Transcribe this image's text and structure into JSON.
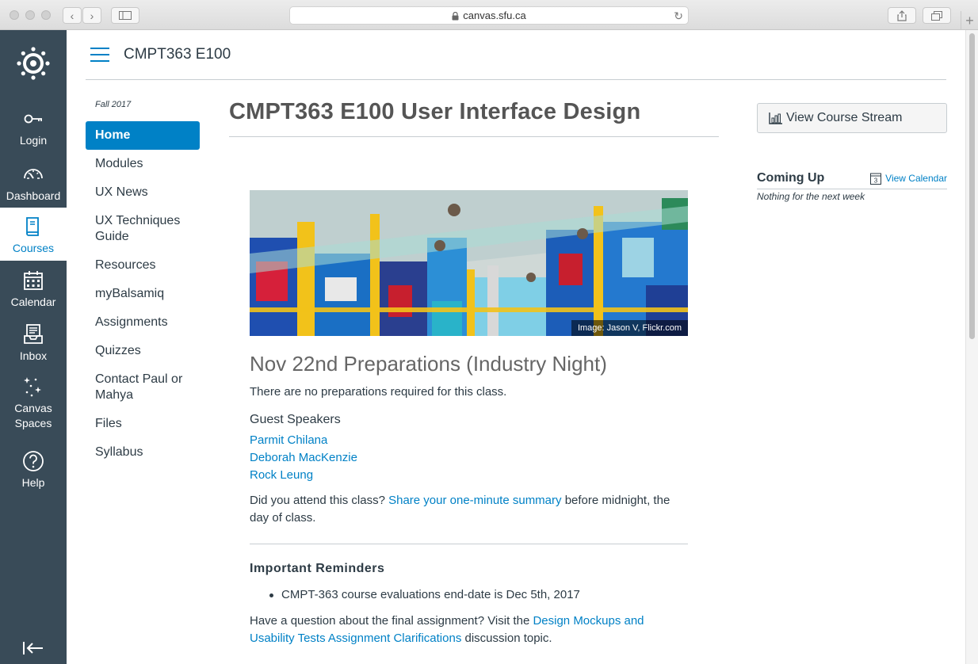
{
  "browser": {
    "url": "canvas.sfu.ca"
  },
  "global_nav": {
    "items": [
      {
        "label": "Login",
        "icon": "key-icon",
        "active": false
      },
      {
        "label": "Dashboard",
        "icon": "dashboard-gauge-icon",
        "active": false
      },
      {
        "label": "Courses",
        "icon": "book-icon",
        "active": true
      },
      {
        "label": "Calendar",
        "icon": "calendar-icon",
        "active": false
      },
      {
        "label": "Inbox",
        "icon": "inbox-icon",
        "active": false
      },
      {
        "label": "Canvas Spaces",
        "label_line1": "Canvas",
        "label_line2": "Spaces",
        "icon": "sparkles-icon",
        "active": false
      },
      {
        "label": "Help",
        "icon": "help-icon",
        "active": false
      }
    ]
  },
  "course_header": {
    "code": "CMPT363 E100"
  },
  "course_nav": {
    "term": "Fall 2017",
    "items": [
      {
        "label": "Home",
        "active": true
      },
      {
        "label": "Modules"
      },
      {
        "label": "UX News"
      },
      {
        "label": "UX Techniques Guide",
        "line1": "UX Techniques",
        "line2": "Guide"
      },
      {
        "label": "Resources"
      },
      {
        "label": "myBalsamiq"
      },
      {
        "label": "Assignments"
      },
      {
        "label": "Quizzes"
      },
      {
        "label": "Contact Paul or Mahya",
        "line1": "Contact Paul or",
        "line2": "Mahya"
      },
      {
        "label": "Files"
      },
      {
        "label": "Syllabus"
      }
    ]
  },
  "main": {
    "title": "CMPT363 E100 User Interface Design",
    "banner_credit": "Image: Jason V, Flickr.com",
    "section_heading": "Nov 22nd Preparations (Industry Night)",
    "prep_text": "There are no preparations required for this class.",
    "guest_heading": "Guest Speakers",
    "speakers": [
      "Parmit Chilana",
      "Deborah MacKenzie",
      "Rock Leung"
    ],
    "attend_prefix": "Did you attend this class? ",
    "attend_link": "Share your one-minute summary",
    "attend_suffix": " before midnight, the",
    "attend_line2": "day of class.",
    "reminders_heading": "Important Reminders",
    "reminders": [
      "CMPT-363 course evaluations end-date is Dec 5th, 2017"
    ],
    "question_prefix": "Have a question about the final assignment? Visit the ",
    "question_link_line1": "Design Mockups and",
    "question_link_line2": "Usability Tests Assignment Clarifications",
    "question_suffix": " discussion topic."
  },
  "sidebar": {
    "stream_button": "View Course Stream",
    "coming_up": "Coming Up",
    "view_calendar": "View Calendar",
    "calendar_day": "3",
    "nothing": "Nothing for the next week"
  },
  "colors": {
    "accent": "#0081c6",
    "global_nav_bg": "#394b58",
    "text": "#2d3b45"
  }
}
